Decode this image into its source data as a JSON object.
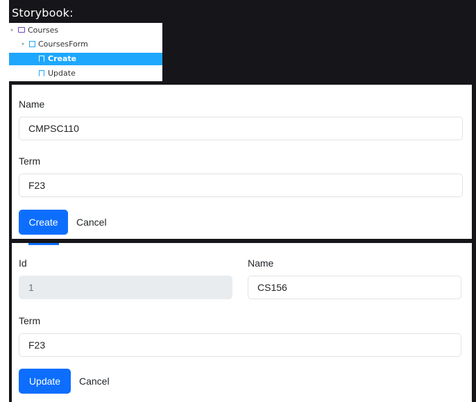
{
  "storybook": {
    "title": "Storybook:",
    "tree": [
      {
        "label": "Courses",
        "kind": "folder"
      },
      {
        "label": "CoursesForm",
        "kind": "component"
      },
      {
        "label": "Create",
        "kind": "story",
        "selected": true
      },
      {
        "label": "Update",
        "kind": "story",
        "selected": false
      }
    ]
  },
  "create_form": {
    "name_label": "Name",
    "name_value": "CMPSC110",
    "term_label": "Term",
    "term_value": "F23",
    "submit_label": "Create",
    "cancel_label": "Cancel"
  },
  "update_form": {
    "id_label": "Id",
    "id_value": "1",
    "name_label": "Name",
    "name_value": "CS156",
    "term_label": "Term",
    "term_value": "F23",
    "submit_label": "Update",
    "cancel_label": "Cancel"
  },
  "colors": {
    "primary": "#0d6efd",
    "selection": "#1ea7fd",
    "background_dark": "#16161a"
  }
}
